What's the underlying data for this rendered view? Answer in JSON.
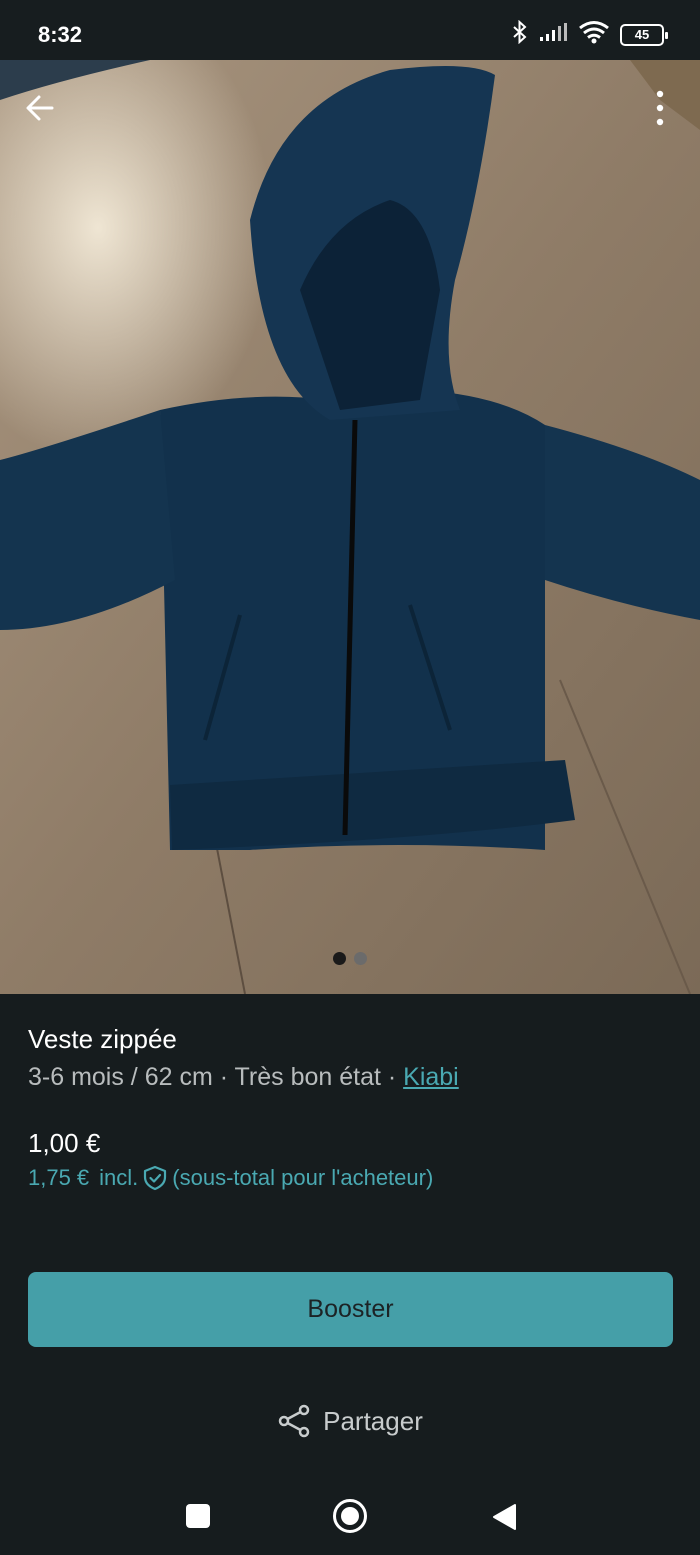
{
  "status_bar": {
    "time": "8:32",
    "battery": "45",
    "icons": [
      "bluetooth-icon",
      "signal-icon",
      "wifi-icon",
      "battery-icon"
    ]
  },
  "photo": {
    "description_icon": "hoodie-photo",
    "page_count": 2,
    "current_page": 1
  },
  "item": {
    "title": "Veste zippée",
    "size": "3-6 mois / 62 cm",
    "separator": " · ",
    "condition": "Très bon état",
    "brand": "Kiabi"
  },
  "pricing": {
    "price": "1,00 €",
    "buyer_price": "1,75 €",
    "incl_label": "incl.",
    "buyer_note": "(sous-total pour l'acheteur)"
  },
  "actions": {
    "booster_label": "Booster",
    "share_label": "Partager"
  },
  "colors": {
    "accent": "#459fa8",
    "link": "#4aa9b2",
    "background": "#161c1e"
  }
}
